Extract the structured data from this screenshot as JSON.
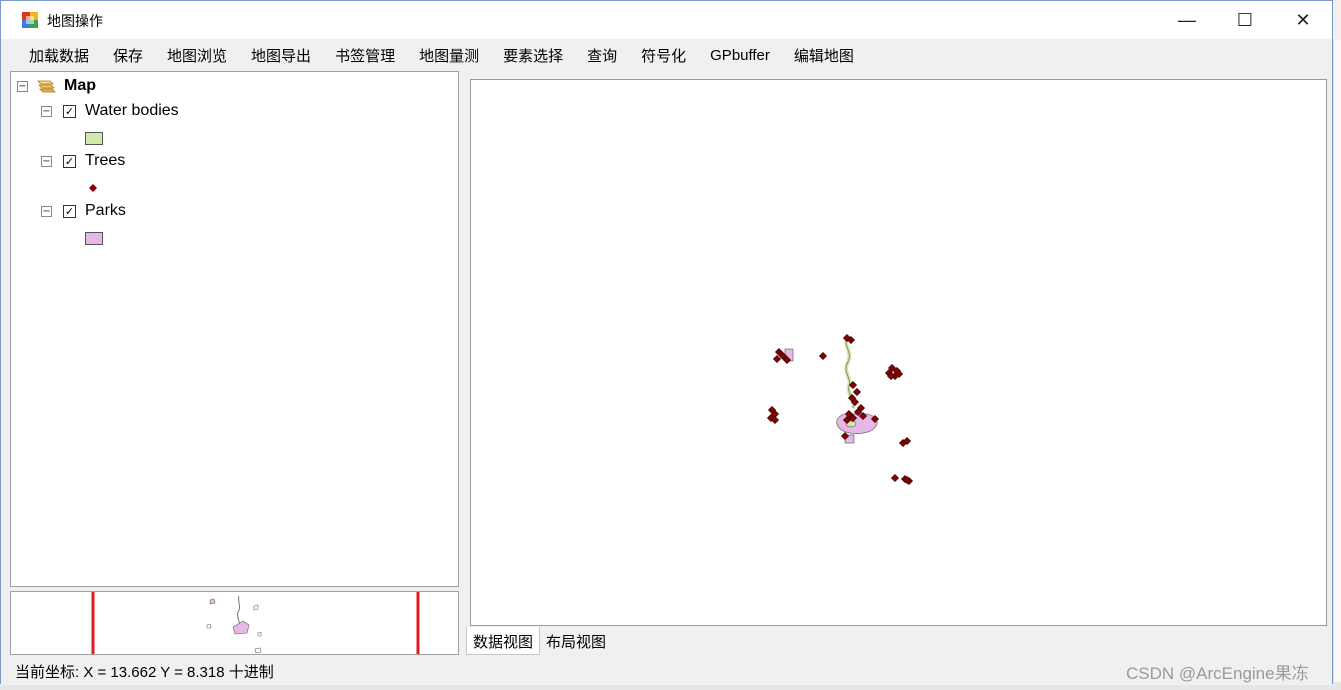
{
  "window": {
    "title": "地图操作",
    "min_glyph": "—",
    "max_glyph": "☐",
    "close_glyph": "✕"
  },
  "menu": [
    "加载数据",
    "保存",
    "地图浏览",
    "地图导出",
    "书签管理",
    "地图量测",
    "要素选择",
    "查询",
    "符号化",
    "GPbuffer",
    "编辑地图"
  ],
  "toc": {
    "root": {
      "label": "Map",
      "expander": "−"
    },
    "layers": [
      {
        "label": "Water bodies",
        "checked": true,
        "check_glyph": "✓",
        "expander": "−",
        "symbol": "polygon",
        "fill": "#d3e8b0"
      },
      {
        "label": "Trees",
        "checked": true,
        "check_glyph": "✓",
        "expander": "−",
        "symbol": "point",
        "fill": "#8b0000"
      },
      {
        "label": "Parks",
        "checked": true,
        "check_glyph": "✓",
        "expander": "−",
        "symbol": "polygon",
        "fill": "#e6b8e6"
      }
    ]
  },
  "tabs": [
    "数据视图",
    "布局视图"
  ],
  "status": {
    "coords": "当前坐标:  X = 13.662 Y = 8.318 十进制"
  },
  "watermark": "CSDN @ArcEngine果冻",
  "colors": {
    "tree_fill": "#8b0000",
    "park_fill": "#e6b8e6",
    "water_fill": "#d3e8b0",
    "overview_extent": "#e31a1c"
  },
  "icons": {
    "app": "map-app-icon",
    "map_root": "layers-stack-icon"
  }
}
